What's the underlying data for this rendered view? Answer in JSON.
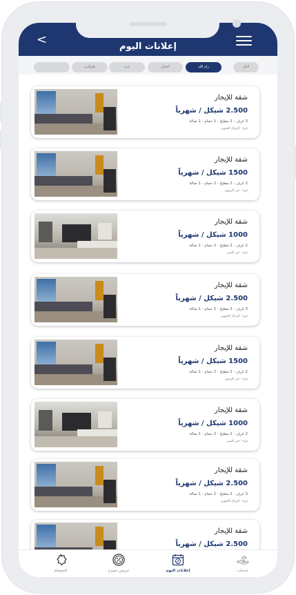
{
  "header": {
    "back_icon": "chevron-left-icon",
    "back_label": "<",
    "title": "إعلانات اليوم",
    "menu_icon": "hamburger-menu-icon"
  },
  "filters": [
    {
      "label": "الكل",
      "active": false
    },
    {
      "label": "رام الله",
      "active": true
    },
    {
      "label": "الخليل",
      "active": false
    },
    {
      "label": "غزة",
      "active": false
    },
    {
      "label": "طولكرم",
      "active": false
    },
    {
      "label": "",
      "active": false
    }
  ],
  "listings": [
    {
      "title": "شقة للإيجار",
      "price": "2.500 شيكل / شهرياً",
      "details": "3 غرف - 2 مطبخ - 1 حمام - 1 صالة",
      "location": "غزة - الرمال الجنوبي",
      "image": "interior-grey-sofa"
    },
    {
      "title": "شقة للإيجار",
      "price": "1500 شيكل / شهرياً",
      "details": "2 غرف - 2 مطبخ - 2 حمام - 1 صالة",
      "location": "غزة - حي الزيتون",
      "image": "interior-grey-sofa"
    },
    {
      "title": "شقة للإيجار",
      "price": "1000 شيكل / شهرياً",
      "details": "2 غرف - 2 مطبخ - 2 حمام - 1 صالة",
      "location": "غزة - حي النصر",
      "image": "interior-white-living"
    },
    {
      "title": "شقة للإيجار",
      "price": "2.500 شيكل / شهرياً",
      "details": "3 غرف - 2 مطبخ - 1 حمام - 1 صالة",
      "location": "غزة - الرمال الجنوبي",
      "image": "interior-grey-sofa"
    },
    {
      "title": "شقة للإيجار",
      "price": "1500 شيكل / شهرياً",
      "details": "2 غرف - 2 مطبخ - 2 حمام - 1 صالة",
      "location": "غزة - حي الزيتون",
      "image": "interior-grey-sofa"
    },
    {
      "title": "شقة للإيجار",
      "price": "1000 شيكل / شهرياً",
      "details": "2 غرف - 2 مطبخ - 2 حمام - 1 صالة",
      "location": "غزة - حي النصر",
      "image": "interior-white-living"
    },
    {
      "title": "شقة للإيجار",
      "price": "2.500 شيكل / شهرياً",
      "details": "3 غرف - 2 مطبخ - 1 حمام - 1 صالة",
      "location": "غزة - الرمال الجنوبي",
      "image": "interior-grey-sofa"
    },
    {
      "title": "شقة للإيجار",
      "price": "2.500 شيكل / شهرياً",
      "details": "",
      "location": "",
      "image": "interior-grey-sofa"
    }
  ],
  "bottom_nav": [
    {
      "label": "المفضلة",
      "icon": "badge-star-icon",
      "active": false
    },
    {
      "label": "عروض مميزة",
      "icon": "discount-icon",
      "active": false
    },
    {
      "label": "إعلانات اليوم",
      "icon": "calendar-percent-icon",
      "active": true
    },
    {
      "label": "خدمات",
      "icon": "hand-service-icon",
      "active": false
    }
  ],
  "colors": {
    "primary": "#1e3770",
    "chip_inactive": "#d8d9db",
    "background": "#ffffff"
  }
}
